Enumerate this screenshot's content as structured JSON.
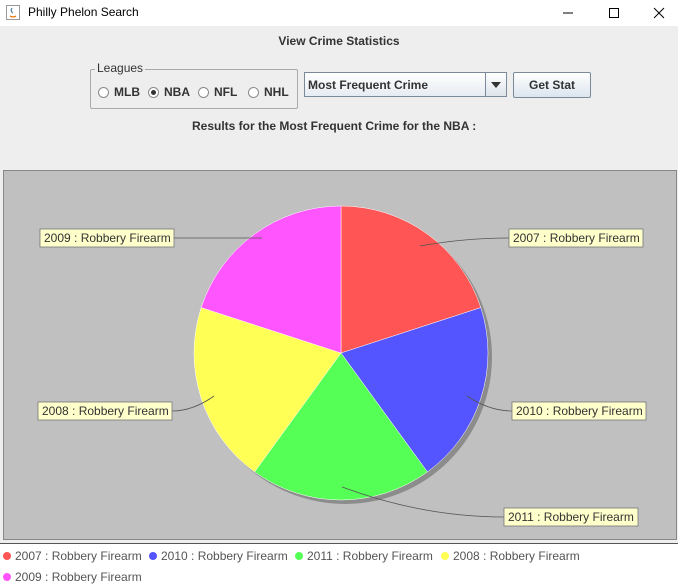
{
  "window": {
    "title": "Philly Phelon Search"
  },
  "header": {
    "heading": "View Crime Statistics"
  },
  "leagues": {
    "label": "Leagues",
    "options": [
      "MLB",
      "NBA",
      "NFL",
      "NHL"
    ],
    "selected": "NBA"
  },
  "stat_select": {
    "value": "Most Frequent Crime"
  },
  "get_stat": {
    "label": "Get Stat"
  },
  "results_text": "Results for the Most Frequent Crime for the NBA :",
  "chart_data": {
    "type": "pie",
    "slices": [
      {
        "label": "2007 : Robbery Firearm",
        "value": 1,
        "color": "#ff5555"
      },
      {
        "label": "2010 : Robbery Firearm",
        "value": 1,
        "color": "#5555ff"
      },
      {
        "label": "2011 : Robbery Firearm",
        "value": 1,
        "color": "#55ff55"
      },
      {
        "label": "2008 : Robbery Firearm",
        "value": 1,
        "color": "#ffff55"
      },
      {
        "label": "2009 : Robbery Firearm",
        "value": 1,
        "color": "#ff55ff"
      }
    ],
    "legend_placement": "bottom"
  },
  "legend": [
    {
      "label": "2007 : Robbery Firearm",
      "color": "#ff5555"
    },
    {
      "label": "2010 : Robbery Firearm",
      "color": "#5555ff"
    },
    {
      "label": "2011 : Robbery Firearm",
      "color": "#55ff55"
    },
    {
      "label": "2008 : Robbery Firearm",
      "color": "#ffff55"
    },
    {
      "label": "2009 : Robbery Firearm",
      "color": "#ff55ff"
    }
  ]
}
